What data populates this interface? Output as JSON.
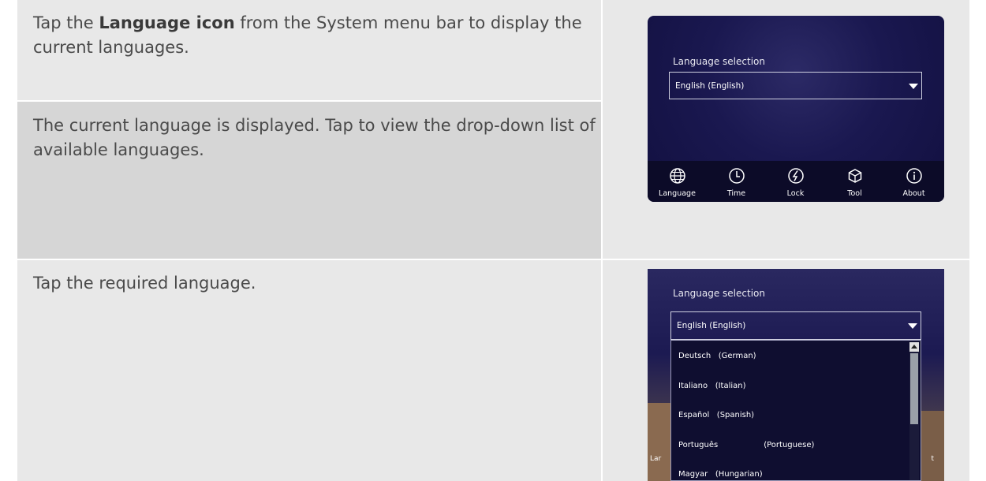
{
  "steps": [
    {
      "prefix": "Tap the ",
      "bold": "Language icon",
      "suffix": " from the System menu bar to display the current languages."
    },
    {
      "text": "The current language is displayed. Tap to view the drop-down list of available languages."
    },
    {
      "text": "Tap the required language."
    }
  ],
  "screen1": {
    "label": "Language selection",
    "selected": "English (English)",
    "menu": [
      {
        "label": "Language",
        "icon": "globe-icon"
      },
      {
        "label": "Time",
        "icon": "clock-icon"
      },
      {
        "label": "Lock",
        "icon": "lock-bolt-icon"
      },
      {
        "label": "Tool",
        "icon": "cube-icon"
      },
      {
        "label": "About",
        "icon": "info-icon"
      }
    ]
  },
  "screen2": {
    "label": "Language selection",
    "selected": "English (English)",
    "options": [
      {
        "name": "Deutsch",
        "native": "(German)"
      },
      {
        "name": "Italiano",
        "native": "(Italian)"
      },
      {
        "name": "Español",
        "native": "(Spanish)"
      },
      {
        "name": "Português",
        "native": "(Portuguese)"
      },
      {
        "name": "Magyar",
        "native": "(Hungarian)"
      }
    ],
    "frag_left": "Lar",
    "frag_right": "t"
  }
}
